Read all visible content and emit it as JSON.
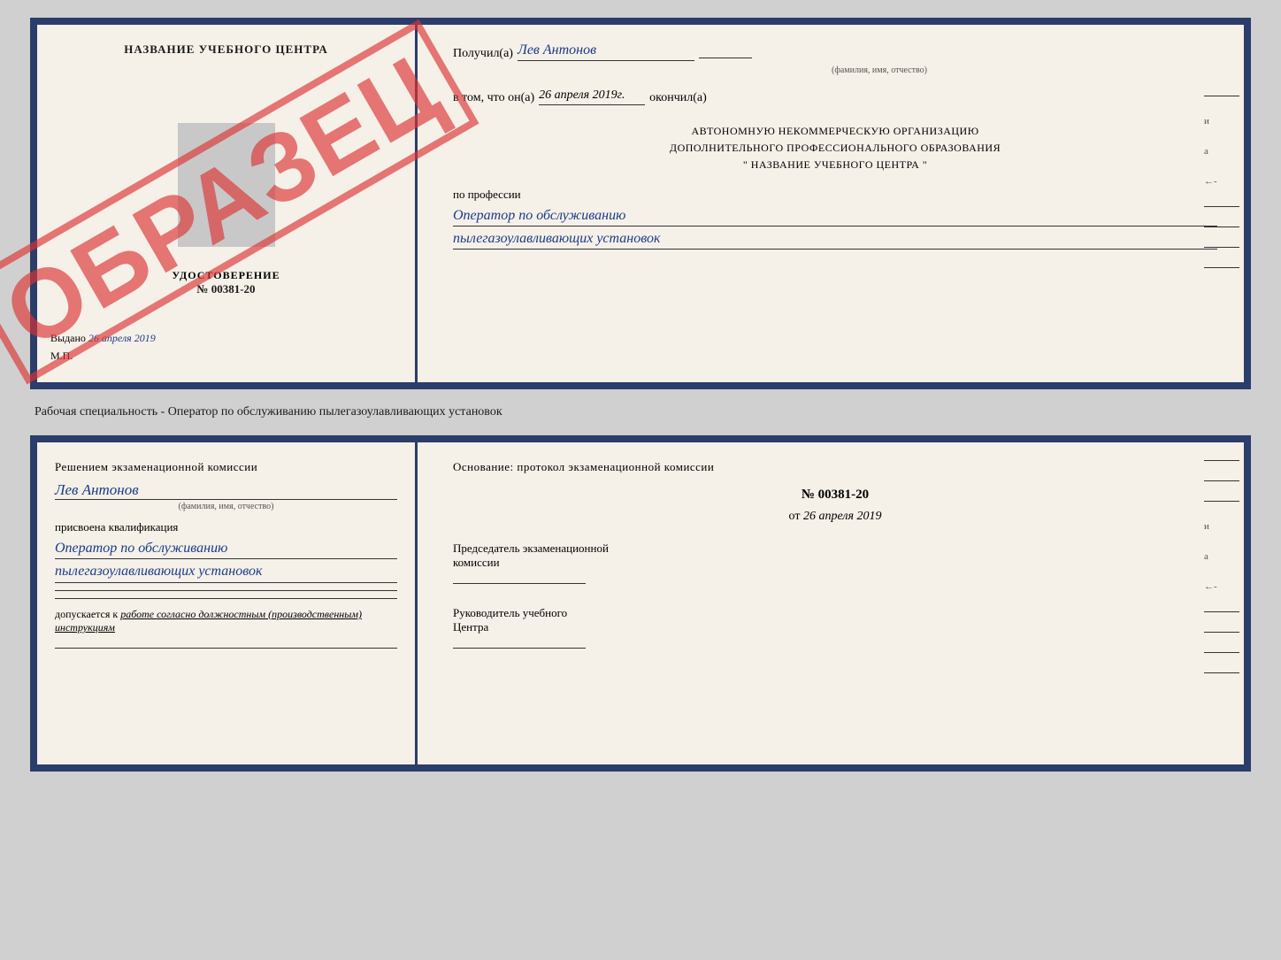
{
  "top_cert": {
    "left": {
      "institution_name": "НАЗВАНИЕ УЧЕБНОГО ЦЕНТРА",
      "udostoverenie_label": "УДОСТОВЕРЕНИЕ",
      "cert_number": "№ 00381-20",
      "vydano_label": "Выдано",
      "vydano_date": "26 апреля 2019",
      "mp_label": "М.П.",
      "obrazec": "ОБРАЗЕЦ"
    },
    "right": {
      "poluchil_label": "Получил(а)",
      "poluchil_name": "Лев Антонов",
      "fio_sublabel": "(фамилия, имя, отчество)",
      "vtom_label": "в том, что он(а)",
      "vtom_date": "26 апреля 2019г.",
      "okonchal_label": "окончил(а)",
      "org_line1": "АВТОНОМНУЮ НЕКОММЕРЧЕСКУЮ ОРГАНИЗАЦИЮ",
      "org_line2": "ДОПОЛНИТЕЛЬНОГО ПРОФЕССИОНАЛЬНОГО ОБРАЗОВАНИЯ",
      "org_line3": "\"  НАЗВАНИЕ УЧЕБНОГО ЦЕНТРА  \"",
      "po_professii_label": "по профессии",
      "professii_line1": "Оператор по обслуживанию",
      "professii_line2": "пылегазоулавливающих установок"
    }
  },
  "separator": {
    "text": "Рабочая специальность - Оператор по обслуживанию пылегазоулавливающих установок"
  },
  "bottom_cert": {
    "left": {
      "resheniem_label": "Решением экзаменационной комиссии",
      "fio_name": "Лев Антонов",
      "fio_sublabel": "(фамилия, имя, отчество)",
      "prisvoena_label": "присвоена квалификация",
      "kvalif_line1": "Оператор по обслуживанию",
      "kvalif_line2": "пылегазоулавливающих установок",
      "dopuskaetsya_label": "допускается к",
      "dopuskaetsya_text": "работе согласно должностным (производственным) инструкциям"
    },
    "right": {
      "osnovanie_label": "Основание: протокол экзаменационной комиссии",
      "protokol_number": "№  00381-20",
      "ot_label": "от",
      "ot_date": "26 апреля 2019",
      "predsedatel_line1": "Председатель экзаменационной",
      "predsedatel_line2": "комиссии",
      "rukovoditel_line1": "Руководитель учебного",
      "rukovoditel_line2": "Центра"
    }
  },
  "side_labels": {
    "i": "и",
    "a": "а",
    "arrow": "←-"
  }
}
